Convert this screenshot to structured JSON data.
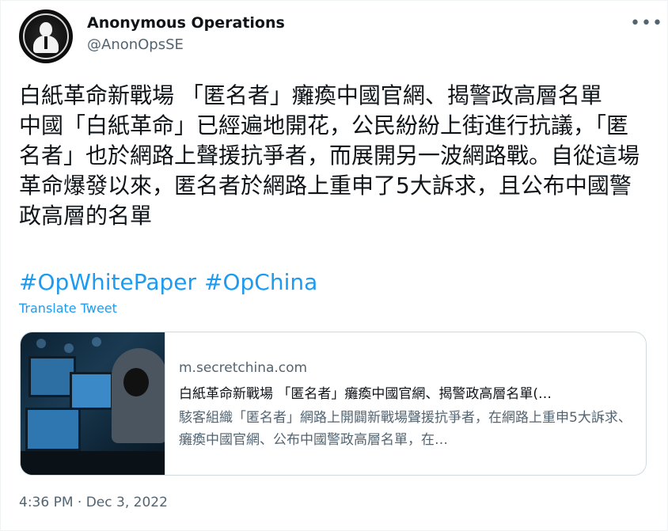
{
  "author": {
    "name": "Anonymous Operations",
    "handle": "@AnonOpsSE",
    "avatar_icon": "anonymous-mask-logo"
  },
  "more_icon": "more-horizontal-icon",
  "tweet": {
    "lines": [
      "白紙革命新戰場 「匿名者」癱瘓中國官網、揭警政高層名單",
      "中國「白紙革命」已經遍地開花，公民紛紛上街進行抗議，「匿名者」也於網路上聲援抗爭者，而展開另一波網路戰。自從這場革命爆發以來，匿名者於網路上重申了5大訴求，且公布中國警政高層的名單"
    ],
    "hashtags": [
      "#OpWhitePaper",
      "#OpChina"
    ],
    "translate_label": "Translate Tweet"
  },
  "card": {
    "domain": "m.secretchina.com",
    "title": "白紙革命新戰場 「匿名者」癱瘓中國官網、揭警政高層名單(…",
    "description": "駭客組織「匿名者」網路上開闢新戰場聲援抗爭者，在網路上重申5大訴求、癱瘓中國官網、公布中國警政高層名單，在…"
  },
  "timestamp": "4:36 PM · Dec 3, 2022",
  "colors": {
    "link": "#1d9bf0",
    "text": "#0f1419",
    "secondary": "#536471",
    "border": "#cfd9de"
  }
}
